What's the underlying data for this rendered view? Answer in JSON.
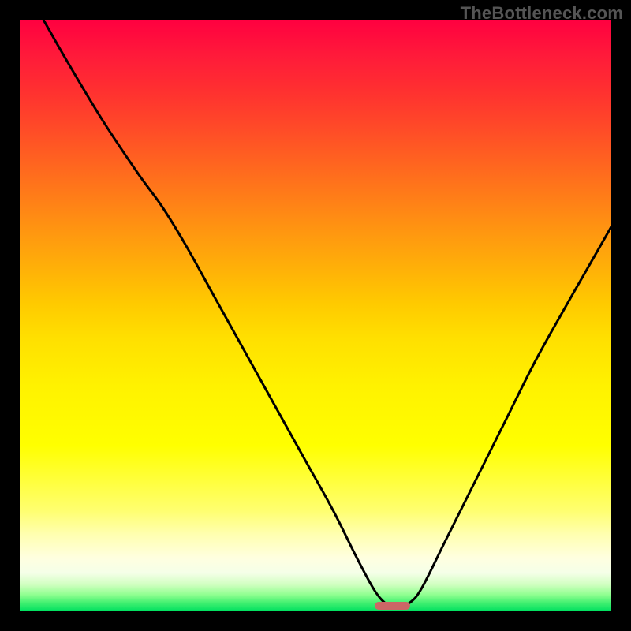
{
  "watermark": {
    "text": "TheBottleneck.com"
  },
  "colors": {
    "frame": "#000000",
    "curve": "#000000",
    "marker": "#cc6666",
    "watermark": "#555555",
    "gradient_stops": [
      {
        "offset": 0.0,
        "color": "#ff0040"
      },
      {
        "offset": 0.06,
        "color": "#ff1a3a"
      },
      {
        "offset": 0.12,
        "color": "#ff3030"
      },
      {
        "offset": 0.18,
        "color": "#ff4928"
      },
      {
        "offset": 0.24,
        "color": "#ff6320"
      },
      {
        "offset": 0.3,
        "color": "#ff7d18"
      },
      {
        "offset": 0.36,
        "color": "#ff9710"
      },
      {
        "offset": 0.42,
        "color": "#ffb008"
      },
      {
        "offset": 0.48,
        "color": "#ffca00"
      },
      {
        "offset": 0.54,
        "color": "#ffe000"
      },
      {
        "offset": 0.62,
        "color": "#fff200"
      },
      {
        "offset": 0.72,
        "color": "#ffff00"
      },
      {
        "offset": 0.83,
        "color": "#ffff70"
      },
      {
        "offset": 0.87,
        "color": "#ffffb0"
      },
      {
        "offset": 0.91,
        "color": "#ffffe0"
      },
      {
        "offset": 0.935,
        "color": "#f5ffe8"
      },
      {
        "offset": 0.955,
        "color": "#d0ffc0"
      },
      {
        "offset": 0.972,
        "color": "#90ff90"
      },
      {
        "offset": 0.986,
        "color": "#40f070"
      },
      {
        "offset": 1.0,
        "color": "#00e060"
      }
    ]
  },
  "chart_data": {
    "type": "line",
    "title": "",
    "xlabel": "",
    "ylabel": "",
    "x_range": [
      0,
      100
    ],
    "y_range": [
      0,
      100
    ],
    "optimum_x": 63,
    "left_curve": {
      "name": "descending",
      "points": [
        {
          "x": 4.0,
          "y": 100.0
        },
        {
          "x": 8.0,
          "y": 93.0
        },
        {
          "x": 14.0,
          "y": 83.0
        },
        {
          "x": 20.0,
          "y": 74.0
        },
        {
          "x": 24.0,
          "y": 68.5
        },
        {
          "x": 28.0,
          "y": 62.0
        },
        {
          "x": 33.0,
          "y": 53.0
        },
        {
          "x": 38.0,
          "y": 44.0
        },
        {
          "x": 43.0,
          "y": 35.0
        },
        {
          "x": 48.0,
          "y": 26.0
        },
        {
          "x": 53.0,
          "y": 17.0
        },
        {
          "x": 57.0,
          "y": 9.0
        },
        {
          "x": 60.0,
          "y": 3.5
        },
        {
          "x": 62.0,
          "y": 1.2
        },
        {
          "x": 63.0,
          "y": 1.0
        }
      ]
    },
    "right_curve": {
      "name": "ascending",
      "points": [
        {
          "x": 64.5,
          "y": 1.0
        },
        {
          "x": 66.0,
          "y": 1.5
        },
        {
          "x": 68.0,
          "y": 4.0
        },
        {
          "x": 72.0,
          "y": 12.0
        },
        {
          "x": 77.0,
          "y": 22.0
        },
        {
          "x": 82.0,
          "y": 32.0
        },
        {
          "x": 87.0,
          "y": 42.0
        },
        {
          "x": 92.0,
          "y": 51.0
        },
        {
          "x": 96.0,
          "y": 58.0
        },
        {
          "x": 100.0,
          "y": 65.0
        }
      ]
    },
    "marker": {
      "x_start": 60.0,
      "x_end": 66.0,
      "y": 1.0
    }
  }
}
